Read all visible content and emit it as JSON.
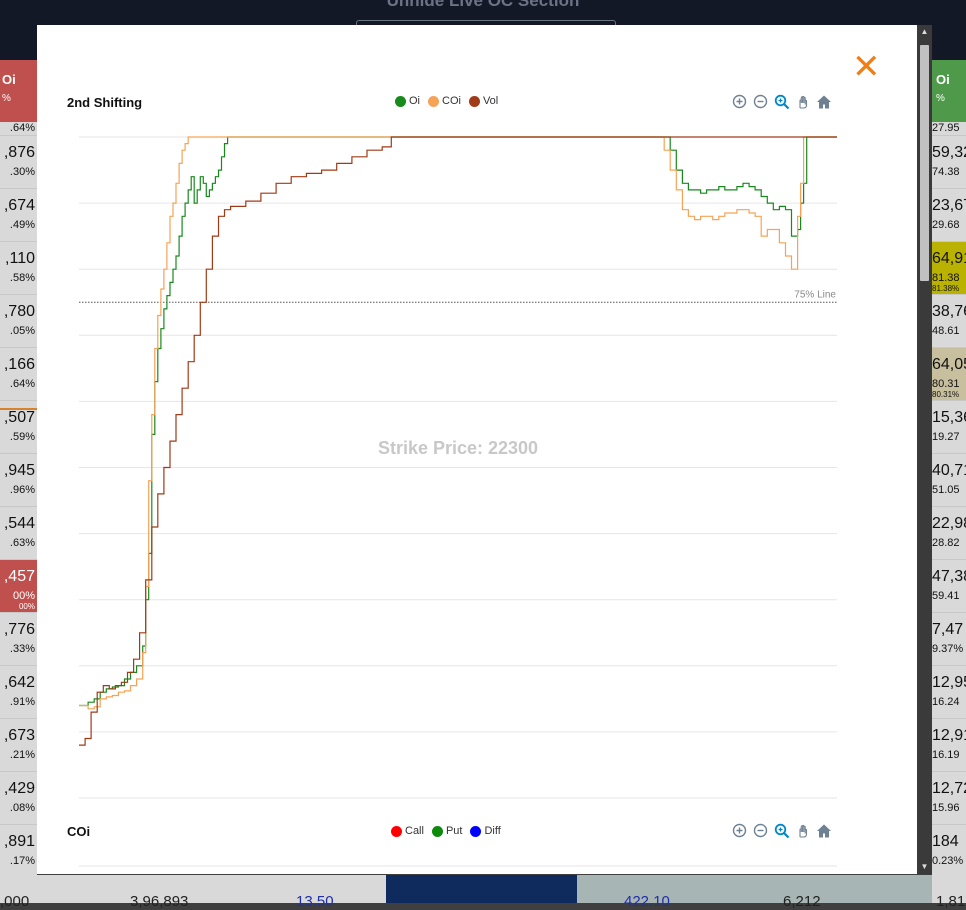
{
  "page": {
    "title": "Unhide Live OC Section"
  },
  "background": {
    "left_header": {
      "label": "Oi",
      "sub": "%"
    },
    "right_header": {
      "label": "Oi",
      "sub": "%"
    },
    "left_cells": [
      {
        "value": "",
        "pct": ".64%"
      },
      {
        "value": ",876",
        "pct": ".30%"
      },
      {
        "value": ",674",
        "pct": ".49%"
      },
      {
        "value": ",110",
        "pct": ".58%"
      },
      {
        "value": ",780",
        "pct": ".05%"
      },
      {
        "value": ",166",
        "pct": ".64%"
      },
      {
        "value": ",507",
        "pct": ".59%"
      },
      {
        "value": ",945",
        "pct": ".96%"
      },
      {
        "value": ",544",
        "pct": ".63%"
      },
      {
        "value": ",457",
        "pct": "00%",
        "sub": "00%"
      },
      {
        "value": ",776",
        "pct": ".33%"
      },
      {
        "value": ",642",
        "pct": ".91%"
      },
      {
        "value": ",673",
        "pct": ".21%"
      },
      {
        "value": ",429",
        "pct": ".08%"
      },
      {
        "value": ",891",
        "pct": ".17%"
      }
    ],
    "right_cells": [
      {
        "value": "",
        "pct": "27.95"
      },
      {
        "value": "59,32",
        "pct": "74.38"
      },
      {
        "value": "23,67",
        "pct": "29.68"
      },
      {
        "value": "64,91",
        "pct": "81.38",
        "sub": "81.38%"
      },
      {
        "value": "38,76",
        "pct": "48.61"
      },
      {
        "value": "64,05",
        "pct": "80.31",
        "sub": "80.31%"
      },
      {
        "value": "15,36",
        "pct": "19.27"
      },
      {
        "value": "40,71",
        "pct": "51.05"
      },
      {
        "value": "22,98",
        "pct": "28.82"
      },
      {
        "value": "47,38",
        "pct": "59.41"
      },
      {
        "value": "7,47",
        "pct": "9.37%"
      },
      {
        "value": "12,95",
        "pct": "16.24"
      },
      {
        "value": "12,91",
        "pct": "16.19"
      },
      {
        "value": "12,72",
        "pct": "15.96"
      },
      {
        "value": "184",
        "pct": "0.23%"
      }
    ],
    "bottom_row": {
      "c1": ",000",
      "c2": "3,96,893",
      "c3": "13.50",
      "c4": "422.10",
      "c5": "6,212",
      "c6": "1,81"
    }
  },
  "modal": {
    "close_label": "✕",
    "chart1": {
      "title": "2nd Shifting",
      "legend": [
        {
          "label": "Oi",
          "color": "#178a1c"
        },
        {
          "label": "COi",
          "color": "#f6a355"
        },
        {
          "label": "Vol",
          "color": "#a13a16"
        }
      ],
      "watermark": "Strike Price: 22300",
      "line_label": "75% Line"
    },
    "chart2": {
      "title": "COi",
      "legend": [
        {
          "label": "Call",
          "color": "#ff0000"
        },
        {
          "label": "Put",
          "color": "#0b8a0b"
        },
        {
          "label": "Diff",
          "color": "#0000ff"
        }
      ]
    },
    "toolbar_icons": [
      "zoom-in-icon",
      "zoom-out-icon",
      "selection-zoom-icon",
      "pan-hand-icon",
      "home-reset-icon"
    ]
  },
  "chart_data": [
    {
      "type": "line",
      "title": "2nd Shifting",
      "legend_position": "top-center",
      "grid": true,
      "ylim": [
        0,
        100
      ],
      "annotations": [
        {
          "type": "horizontal-line",
          "y": 75,
          "label": "75% Line",
          "style": "dotted"
        }
      ],
      "watermark": "Strike Price: 22300",
      "series": [
        {
          "name": "Oi",
          "color": "#178a1c",
          "points": [
            [
              0,
              14
            ],
            [
              3,
              14.5
            ],
            [
              5,
              15
            ],
            [
              7,
              16
            ],
            [
              9,
              16.5
            ],
            [
              11,
              16.8
            ],
            [
              13,
              17
            ],
            [
              15,
              18
            ],
            [
              17,
              19
            ],
            [
              19,
              20
            ],
            [
              21,
              23
            ],
            [
              22,
              30
            ],
            [
              23,
              37
            ],
            [
              24,
              55
            ],
            [
              25,
              63
            ],
            [
              26,
              68
            ],
            [
              27,
              71
            ],
            [
              28,
              74
            ],
            [
              29,
              76
            ],
            [
              30,
              78
            ],
            [
              31,
              80
            ],
            [
              32,
              82
            ],
            [
              33,
              85
            ],
            [
              34,
              88
            ],
            [
              35,
              90
            ],
            [
              36,
              92
            ],
            [
              37,
              94
            ],
            [
              38,
              90
            ],
            [
              39,
              92
            ],
            [
              40,
              94
            ],
            [
              41,
              93
            ],
            [
              42,
              91
            ],
            [
              43,
              92
            ],
            [
              44,
              93
            ],
            [
              45,
              94
            ],
            [
              46,
              95
            ],
            [
              47,
              97
            ],
            [
              48,
              99
            ],
            [
              49,
              100
            ],
            [
              50,
              100
            ],
            [
              52,
              100
            ],
            [
              55,
              100
            ],
            [
              60,
              100
            ],
            [
              70,
              100
            ],
            [
              80,
              100
            ],
            [
              90,
              100
            ],
            [
              100,
              100
            ],
            [
              120,
              100
            ],
            [
              140,
              100
            ],
            [
              160,
              100
            ],
            [
              170,
              100
            ],
            [
              180,
              100
            ],
            [
              190,
              100
            ],
            [
              195,
              98
            ],
            [
              197,
              95
            ],
            [
              199,
              93
            ],
            [
              201,
              92
            ],
            [
              203,
              92
            ],
            [
              205,
              91.5
            ],
            [
              207,
              92
            ],
            [
              209,
              92
            ],
            [
              211,
              92.5
            ],
            [
              213,
              92
            ],
            [
              215,
              92
            ],
            [
              217,
              92.5
            ],
            [
              219,
              93
            ],
            [
              221,
              92.5
            ],
            [
              223,
              92
            ],
            [
              225,
              91
            ],
            [
              227,
              90
            ],
            [
              229,
              89
            ],
            [
              231,
              89.5
            ],
            [
              233,
              89
            ],
            [
              235,
              85
            ],
            [
              237,
              86
            ],
            [
              238,
              90
            ],
            [
              239,
              93
            ],
            [
              240,
              100
            ],
            [
              242,
              100
            ],
            [
              250,
              100
            ]
          ]
        },
        {
          "name": "COi",
          "color": "#f6a355",
          "points": [
            [
              0,
              14
            ],
            [
              3,
              13.5
            ],
            [
              5,
              13.8
            ],
            [
              7,
              15
            ],
            [
              9,
              15.3
            ],
            [
              11,
              15.5
            ],
            [
              13,
              16
            ],
            [
              15,
              16.2
            ],
            [
              17,
              17
            ],
            [
              19,
              18
            ],
            [
              21,
              22
            ],
            [
              22,
              32
            ],
            [
              23,
              48
            ],
            [
              24,
              58
            ],
            [
              25,
              68
            ],
            [
              26,
              73
            ],
            [
              27,
              77
            ],
            [
              28,
              80
            ],
            [
              29,
              84
            ],
            [
              30,
              88
            ],
            [
              31,
              90
            ],
            [
              32,
              93
            ],
            [
              33,
              96
            ],
            [
              34,
              98
            ],
            [
              35,
              99
            ],
            [
              36,
              100
            ],
            [
              38,
              100
            ],
            [
              40,
              100
            ],
            [
              50,
              100
            ],
            [
              60,
              100
            ],
            [
              80,
              100
            ],
            [
              100,
              100
            ],
            [
              140,
              100
            ],
            [
              170,
              100
            ],
            [
              190,
              100
            ],
            [
              193,
              98
            ],
            [
              195,
              95
            ],
            [
              197,
              92
            ],
            [
              199,
              89
            ],
            [
              201,
              88
            ],
            [
              203,
              87.5
            ],
            [
              205,
              88
            ],
            [
              207,
              88
            ],
            [
              209,
              87.5
            ],
            [
              211,
              88
            ],
            [
              213,
              88.5
            ],
            [
              215,
              88.5
            ],
            [
              217,
              89
            ],
            [
              219,
              89
            ],
            [
              221,
              88.5
            ],
            [
              223,
              88
            ],
            [
              225,
              85
            ],
            [
              227,
              86
            ],
            [
              229,
              86
            ],
            [
              231,
              84
            ],
            [
              233,
              82
            ],
            [
              235,
              80
            ],
            [
              236,
              80
            ],
            [
              237,
              88
            ],
            [
              238,
              93
            ],
            [
              239,
              100
            ],
            [
              242,
              100
            ],
            [
              250,
              100
            ]
          ]
        },
        {
          "name": "Vol",
          "color": "#a13a16",
          "points": [
            [
              0,
              8
            ],
            [
              2,
              9
            ],
            [
              4,
              13
            ],
            [
              6,
              16
            ],
            [
              8,
              17
            ],
            [
              10,
              16.5
            ],
            [
              12,
              17
            ],
            [
              14,
              17.5
            ],
            [
              16,
              19
            ],
            [
              18,
              21
            ],
            [
              20,
              25
            ],
            [
              22,
              33
            ],
            [
              24,
              41
            ],
            [
              26,
              46
            ],
            [
              28,
              50
            ],
            [
              30,
              54
            ],
            [
              32,
              58
            ],
            [
              34,
              62
            ],
            [
              36,
              66
            ],
            [
              38,
              70
            ],
            [
              40,
              75
            ],
            [
              42,
              80
            ],
            [
              44,
              85
            ],
            [
              46,
              88
            ],
            [
              48,
              89
            ],
            [
              50,
              89.5
            ],
            [
              55,
              90.3
            ],
            [
              60,
              91.5
            ],
            [
              65,
              93
            ],
            [
              70,
              94
            ],
            [
              75,
              94.5
            ],
            [
              80,
              95
            ],
            [
              85,
              96
            ],
            [
              90,
              97
            ],
            [
              95,
              98
            ],
            [
              100,
              98.5
            ],
            [
              103,
              100
            ],
            [
              110,
              100
            ],
            [
              130,
              100
            ],
            [
              170,
              100
            ],
            [
              200,
              100
            ],
            [
              238,
              100
            ],
            [
              240,
              100
            ],
            [
              250,
              100
            ]
          ]
        }
      ]
    },
    {
      "type": "line",
      "title": "COi",
      "legend_position": "top-center",
      "series": [
        {
          "name": "Call",
          "color": "#ff0000",
          "points": []
        },
        {
          "name": "Put",
          "color": "#0b8a0b",
          "points": []
        },
        {
          "name": "Diff",
          "color": "#0000ff",
          "points": []
        }
      ]
    }
  ]
}
